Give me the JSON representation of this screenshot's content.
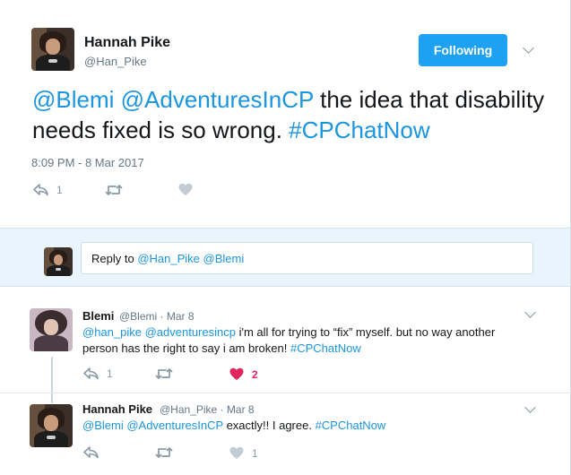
{
  "main_tweet": {
    "author_name": "Hannah Pike",
    "author_handle": "@Han_Pike",
    "follow_label": "Following",
    "mention_1": "@Blemi",
    "mention_2": "@AdventuresInCP",
    "body": " the idea that disability needs fixed is so wrong. ",
    "hashtag": "#CPChatNow",
    "timestamp": "8:09 PM - 8 Mar 2017",
    "reply_count": "1",
    "retweet_count": "",
    "like_count": ""
  },
  "reply_box": {
    "prefix": "Reply to ",
    "mention_1": "@Han_Pike",
    "mention_2": "@Blemi"
  },
  "replies": [
    {
      "author_name": "Blemi",
      "author_handle": "@Blemi",
      "date": "· Mar 8",
      "mention_1": "@han_pike",
      "mention_2": "@adventuresincp",
      "line1_rest": " i'm all for trying to “fix” myself. but no way another",
      "line2": "person has the right to say i am broken! ",
      "hashtag": "#CPChatNow",
      "reply_count": "1",
      "like_count": "2"
    },
    {
      "author_name": "Hannah Pike",
      "author_handle": "@Han_Pike",
      "date": "· Mar 8",
      "mention_1": "@Blemi",
      "mention_2": "@AdventuresInCP",
      "body": " exactly!! I agree. ",
      "hashtag": "#CPChatNow",
      "reply_count": "",
      "like_count": "1"
    }
  ],
  "colors": {
    "accent": "#1b95e0",
    "button": "#1da1f2",
    "like_active": "#e0245e",
    "muted": "#8899a6",
    "reply_bg": "#e8f5fd"
  },
  "icons": [
    "avatar",
    "chevron-down-icon",
    "reply-icon",
    "retweet-icon",
    "heart-icon"
  ]
}
